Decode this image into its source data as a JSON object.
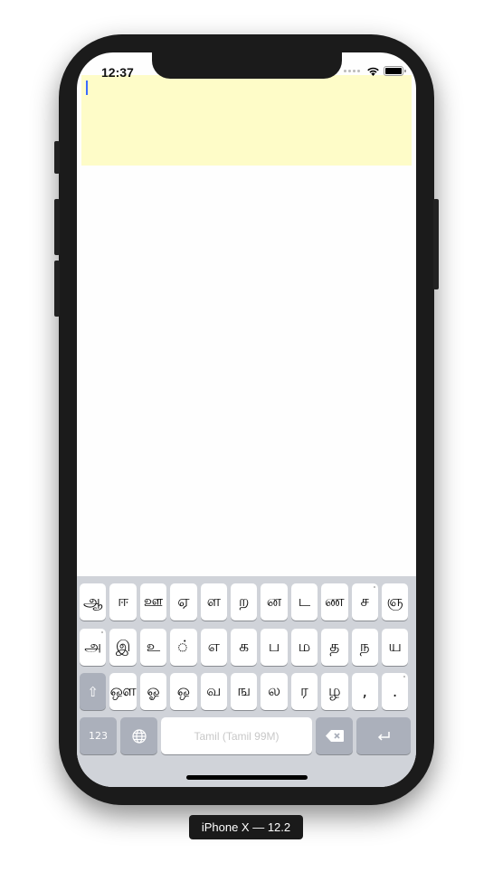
{
  "status_bar": {
    "time": "12:37",
    "icons": [
      "signal-dots-icon",
      "wifi-icon",
      "battery-icon"
    ]
  },
  "text_field": {
    "value": "",
    "background": "#fefcc8",
    "caret_color": "#3b6bff"
  },
  "keyboard": {
    "rows": [
      [
        "ஆ",
        "ஈ",
        "ஊ",
        "ஏ",
        "ள",
        "ற",
        "ன",
        "ட",
        "ண",
        "ச",
        "ஞ"
      ],
      [
        "அ",
        "இ",
        "உ",
        "◌்",
        "எ",
        "க",
        "ப",
        "ம",
        "த",
        "ந",
        "ய"
      ],
      [
        "ஔ",
        "ஓ",
        "ஒ",
        "வ",
        "ங",
        "ல",
        "ர",
        "ழ",
        ",",
        "."
      ]
    ],
    "shift_icon": "⇧",
    "numbers_label": "123",
    "globe_icon": "🌐",
    "space_label": "Tamil (Tamil 99M)",
    "delete_icon": "⌫",
    "return_icon": "⏎"
  },
  "device_label": "iPhone X — 12.2"
}
